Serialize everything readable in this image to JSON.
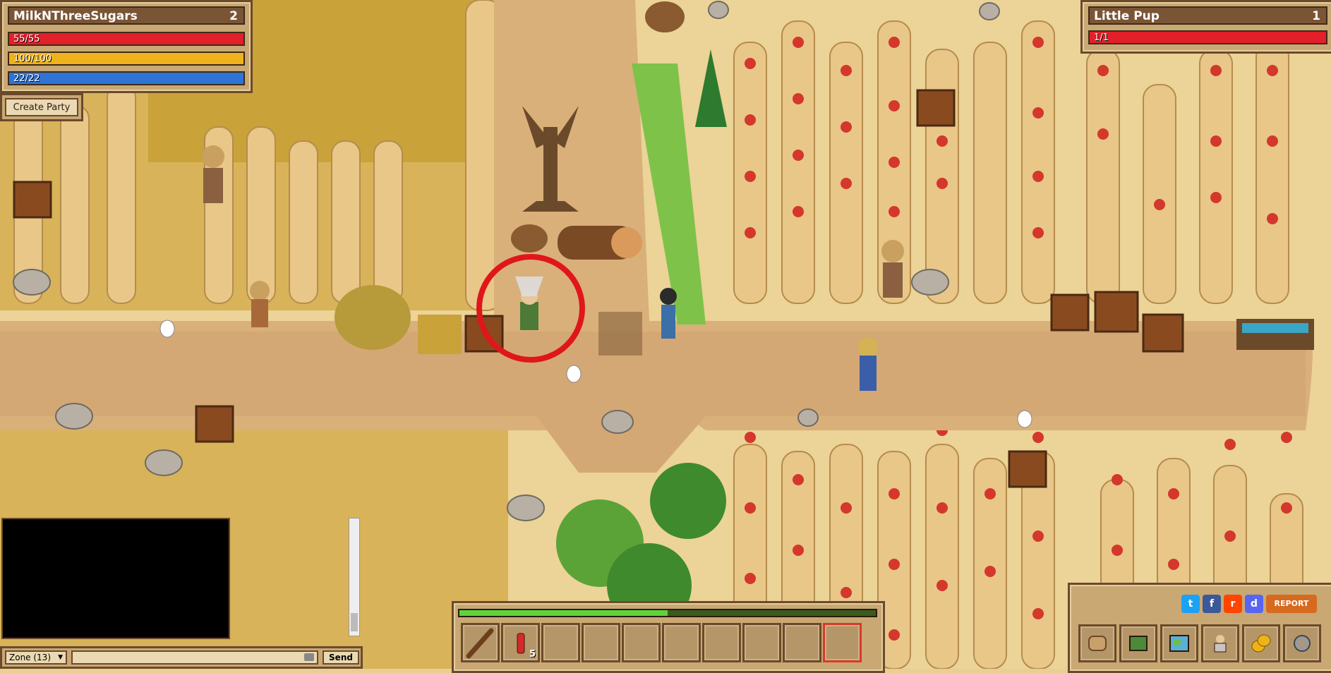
{
  "player": {
    "name": "MilkNThreeSugars",
    "level": "2",
    "hp_text": "55/55",
    "hp_fraction": 1.0,
    "energy_text": "100/100",
    "energy_fraction": 1.0,
    "mana_text": "22/22",
    "mana_fraction": 1.0
  },
  "party_button": "Create Party",
  "target": {
    "name": "Little Pup",
    "level": "1",
    "hp_text": "1/1",
    "hp_fraction": 1.0
  },
  "chat": {
    "channel": "Zone (13)",
    "input_value": "",
    "send_label": "Send"
  },
  "hotbar": {
    "xp_fraction": 0.5,
    "slots": [
      {
        "item": "wooden-club-icon",
        "qty": ""
      },
      {
        "item": "red-potion-icon",
        "qty": "5"
      },
      {
        "item": "",
        "qty": ""
      },
      {
        "item": "",
        "qty": ""
      },
      {
        "item": "",
        "qty": ""
      },
      {
        "item": "",
        "qty": ""
      },
      {
        "item": "",
        "qty": ""
      },
      {
        "item": "",
        "qty": ""
      },
      {
        "item": "",
        "qty": ""
      },
      {
        "item": "",
        "qty": ""
      }
    ]
  },
  "social": {
    "twitter": "t",
    "facebook": "f",
    "reddit": "r",
    "discord": "d",
    "report": "REPORT"
  },
  "menu": [
    "map-scroll-icon",
    "quest-book-icon",
    "world-map-icon",
    "character-icon",
    "coins-icon",
    "settings-gear-icon"
  ],
  "colors": {
    "hp": "#e2202a",
    "energy": "#f0b21a",
    "mana": "#2e74d6",
    "xp": "#5fd33a",
    "target_ring": "#e0161b"
  }
}
